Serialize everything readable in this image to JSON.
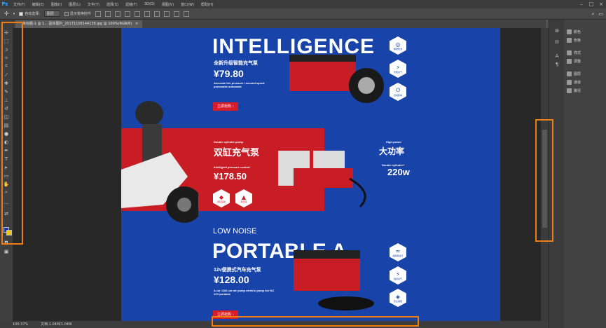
{
  "app": {
    "logo": "Ps"
  },
  "menubar": {
    "items": [
      "文件(F)",
      "编辑(E)",
      "图像(I)",
      "图层(L)",
      "文字(Y)",
      "选择(S)",
      "滤镜(T)",
      "3D(D)",
      "视图(V)",
      "窗口(W)",
      "帮助(H)"
    ]
  },
  "options": {
    "auto_select_label": "自动选择:",
    "auto_select_value": "图层",
    "show_transform_label": "显示变换控件"
  },
  "document": {
    "tab_title": "未标题-1 @ 1... 副本图片_20171108144138.jpg @ 100%(RGB/8)",
    "tab_close": "×"
  },
  "status": {
    "zoom": "100.37%",
    "doc_info": "文档:1.04M/1.04M"
  },
  "panels": {
    "items": [
      "颜色",
      "色板",
      "样式",
      "调整",
      "图层",
      "通道",
      "路径"
    ]
  },
  "artwork": {
    "headline1": "INTELLIGENCE",
    "sub1": "全新升级智能充气泵",
    "price1": "¥79.80",
    "desc1": "Accurate tire pressure / second speed pneumatic automatic",
    "cta": "立即抢购",
    "tag2": "Double cylinder pump",
    "title2": "双缸充气泵",
    "sub2": "Intelligent pressure control",
    "price2": "¥178.50",
    "hp_label": "High-power",
    "hp_title": "大功率",
    "cyl_label": "Double cylinder+",
    "watts": "220w",
    "low_noise": "LOW NOISE",
    "headline3": "PORTABLE A",
    "sub3": "12v便携式汽车充气泵",
    "price3": "¥128.00",
    "desc3": "A car 1381 car air pump electric pump tire NC 12V portable",
    "badges": [
      "精准检测",
      "智能充气",
      "自动断电",
      "四缸强劲",
      "耐高温",
      "超静音运行",
      "强劲充气",
      "安全保障"
    ]
  },
  "colors": {
    "accent_orange": "#f07d13",
    "brand_blue": "#1843a8",
    "brand_red": "#c81d25"
  }
}
